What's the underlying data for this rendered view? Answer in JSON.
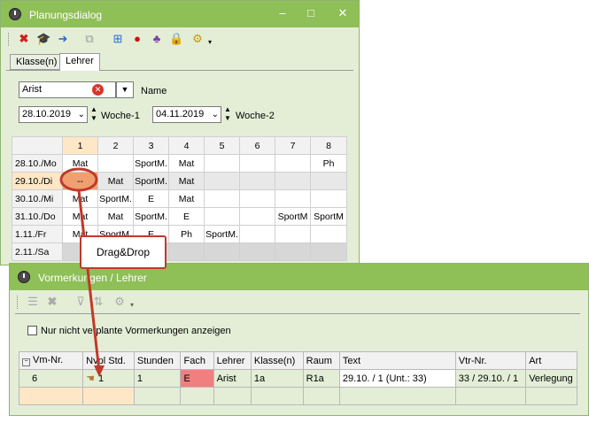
{
  "colors": {
    "window_bg": "#e4eed7",
    "titlebar": "#8fbf57",
    "accent": "#c0392b",
    "highlight": "#fde7c6",
    "subject_red": "#f08080"
  },
  "dialog": {
    "title": "Planungsdialog",
    "minimize": "–",
    "maximize": "□",
    "close": "✕",
    "toolbar_icons": [
      "delete-icon",
      "graduation-cap-icon",
      "export-icon",
      "duplicate-icon",
      "add-grid-icon",
      "pin-icon",
      "people-icon",
      "lock-icon",
      "settings-icon"
    ],
    "tabs": [
      {
        "label": "Klasse(n)",
        "selected": false
      },
      {
        "label": "Lehrer",
        "selected": true
      }
    ],
    "teacher_value": "Arist",
    "name_label": "Name",
    "date_from": "28.10.2019",
    "week1_label": "Woche-1",
    "date_to": "04.11.2019",
    "week2_label": "Woche-2",
    "grid": {
      "columns": [
        "1",
        "2",
        "3",
        "4",
        "5",
        "6",
        "7",
        "8"
      ],
      "rows": [
        {
          "day": "28.10./Mo",
          "cells": [
            "Mat",
            "",
            "SportM.",
            "Mat",
            "",
            "",
            "",
            "Ph"
          ]
        },
        {
          "day": "29.10./Di",
          "cells": [
            "--",
            "Mat",
            "SportM.",
            "Mat",
            "",
            "",
            "",
            ""
          ]
        },
        {
          "day": "30.10./Mi",
          "cells": [
            "Mat",
            "SportM.",
            "E",
            "Mat",
            "",
            "",
            "",
            ""
          ]
        },
        {
          "day": "31.10./Do",
          "cells": [
            "Mat",
            "Mat",
            "SportM.",
            "E",
            "",
            "",
            "SportM",
            "SportM"
          ]
        },
        {
          "day": "1.11./Fr",
          "cells": [
            "Mat",
            "SportM.",
            "E",
            "Ph",
            "SportM.",
            "",
            "",
            ""
          ]
        },
        {
          "day": "2.11./Sa",
          "cells": [
            "",
            "",
            "",
            "",
            "",
            "",
            "",
            ""
          ]
        }
      ]
    }
  },
  "callout": {
    "label": "Drag&Drop"
  },
  "vormerkungen": {
    "title": "Vormerkungen / Lehrer",
    "toolbar_icons": [
      "list-icon",
      "delete-icon",
      "filter-icon",
      "sort-icon",
      "settings-icon"
    ],
    "checkbox_label": "Nur nicht verplante Vormerkungen anzeigen",
    "table": {
      "headers": [
        "Vm-Nr.",
        "Nvpl Std.",
        "Stunden",
        "Fach",
        "Lehrer",
        "Klasse(n)",
        "Raum",
        "Text",
        "Vtr-Nr.",
        "Art"
      ],
      "rows": [
        [
          "6",
          "1",
          "1",
          "E",
          "Arist",
          "1a",
          "R1a",
          "29.10. / 1 (Unt.: 33)",
          "33 / 29.10. / 1",
          "Verlegung"
        ]
      ]
    }
  }
}
